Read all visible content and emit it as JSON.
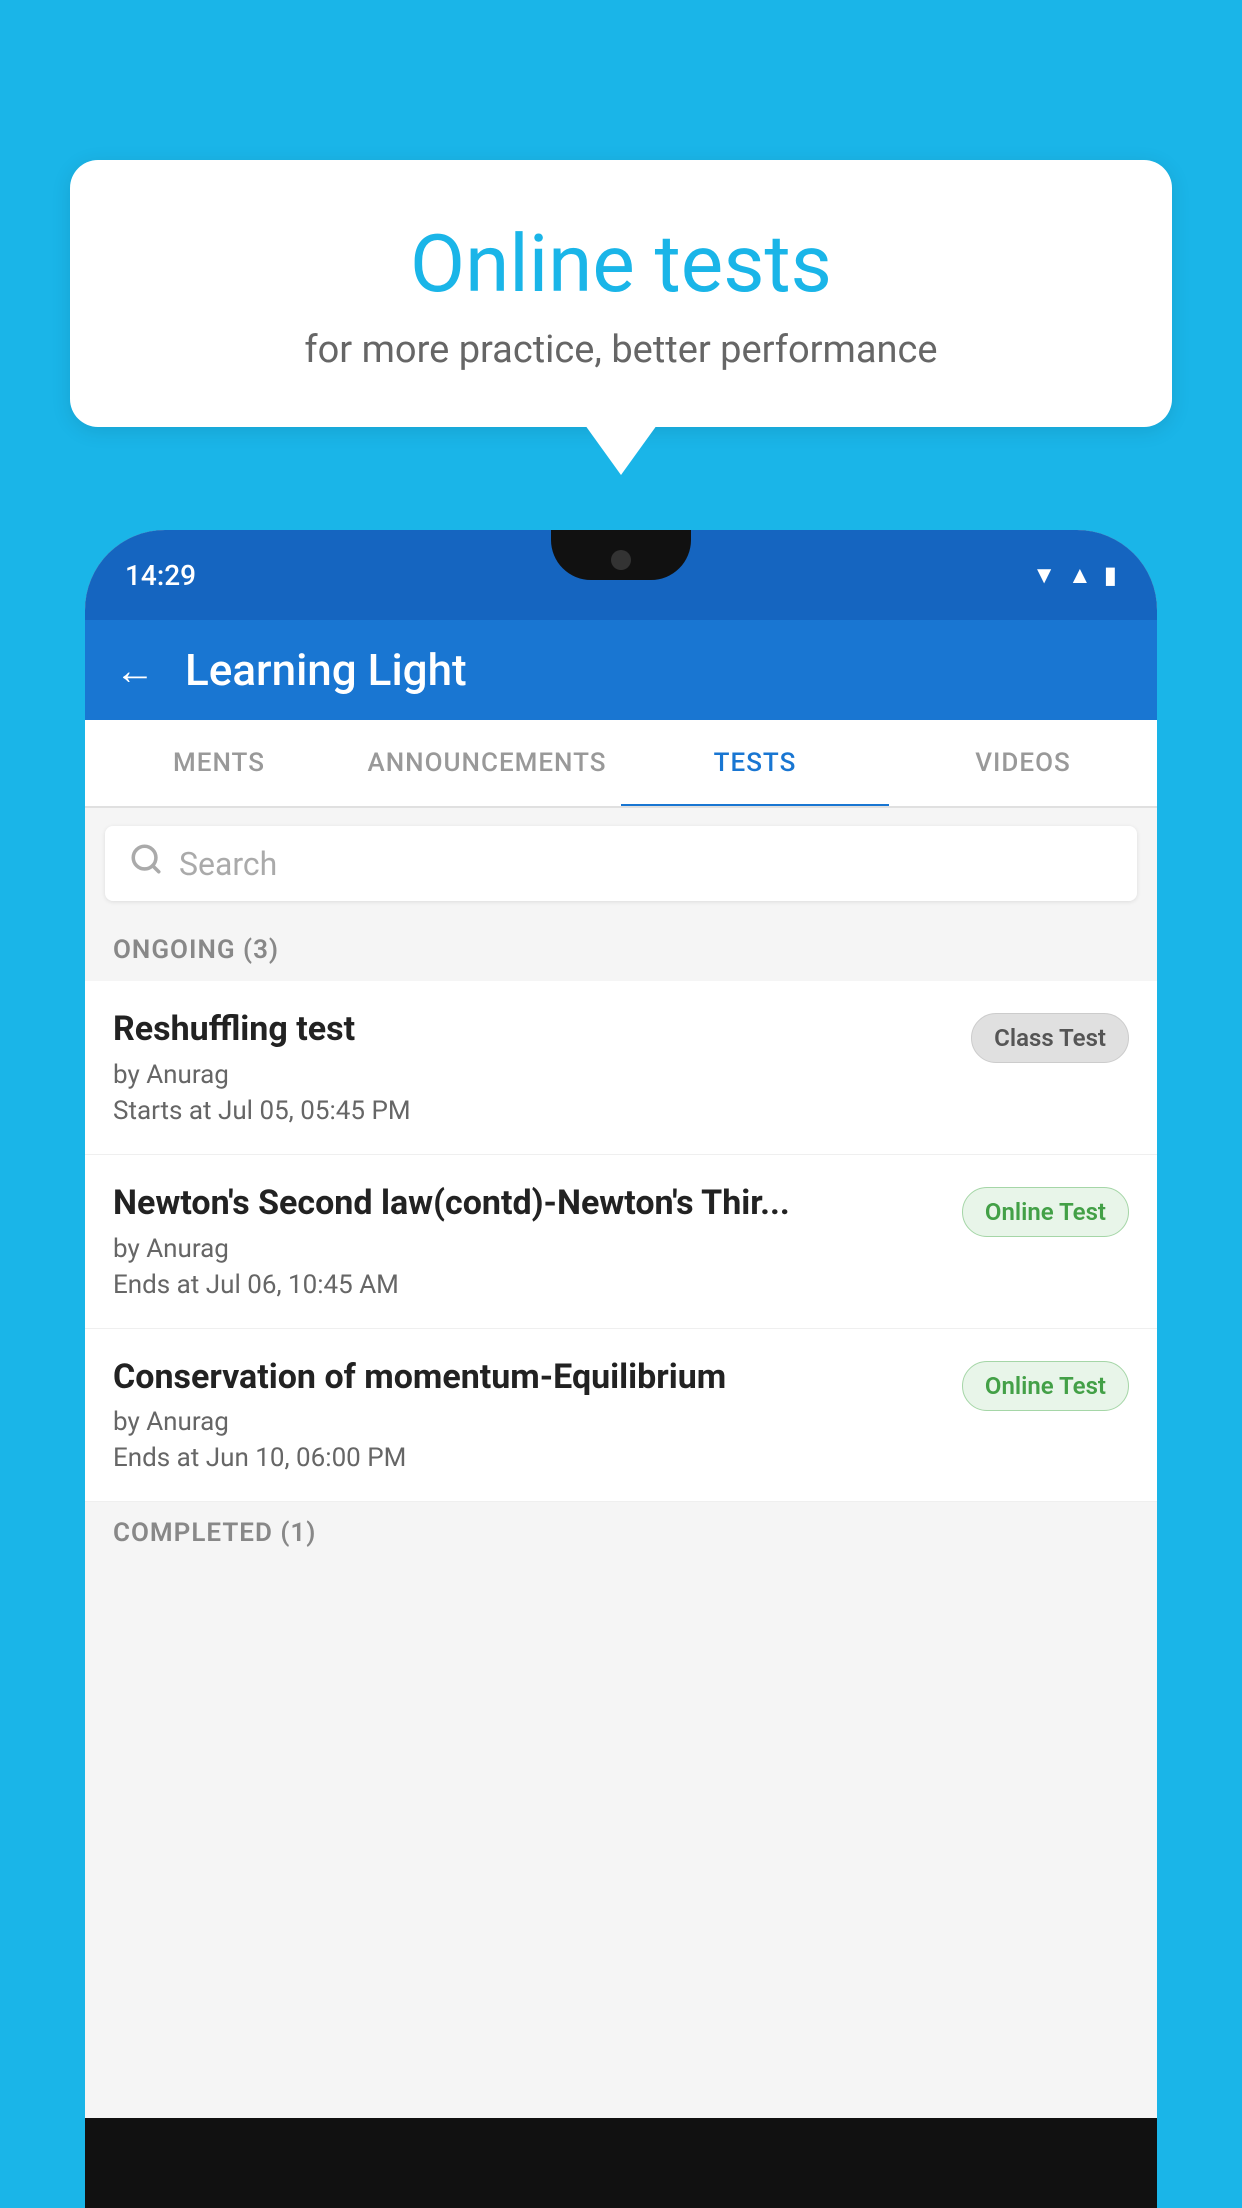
{
  "background_color": "#1ab5e8",
  "bubble": {
    "title": "Online tests",
    "subtitle": "for more practice, better performance"
  },
  "phone": {
    "status_time": "14:29",
    "app_title": "Learning Light",
    "back_label": "←",
    "tabs": [
      {
        "label": "MENTS",
        "active": false
      },
      {
        "label": "ANNOUNCEMENTS",
        "active": false
      },
      {
        "label": "TESTS",
        "active": true
      },
      {
        "label": "VIDEOS",
        "active": false
      }
    ],
    "search_placeholder": "Search",
    "section_ongoing": "ONGOING (3)",
    "section_completed": "COMPLETED (1)",
    "tests": [
      {
        "name": "Reshuffling test",
        "author": "by Anurag",
        "date": "Starts at  Jul 05, 05:45 PM",
        "badge": "Class Test",
        "badge_type": "class"
      },
      {
        "name": "Newton's Second law(contd)-Newton's Thir...",
        "author": "by Anurag",
        "date": "Ends at  Jul 06, 10:45 AM",
        "badge": "Online Test",
        "badge_type": "online"
      },
      {
        "name": "Conservation of momentum-Equilibrium",
        "author": "by Anurag",
        "date": "Ends at  Jun 10, 06:00 PM",
        "badge": "Online Test",
        "badge_type": "online"
      }
    ]
  }
}
